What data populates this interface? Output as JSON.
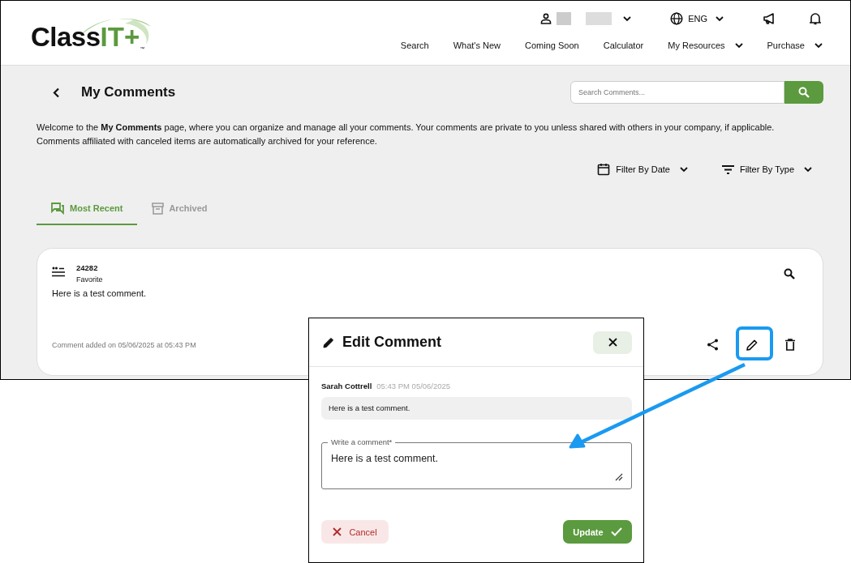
{
  "header": {
    "logo_text": "Class",
    "logo_accent": "IT+",
    "logo_tm": "™",
    "language": "ENG",
    "nav": [
      {
        "label": "Search",
        "dropdown": false
      },
      {
        "label": "What's New",
        "dropdown": false
      },
      {
        "label": "Coming Soon",
        "dropdown": false
      },
      {
        "label": "Calculator",
        "dropdown": false
      },
      {
        "label": "My Resources",
        "dropdown": true
      },
      {
        "label": "Purchase",
        "dropdown": true
      }
    ]
  },
  "page": {
    "title": "My Comments",
    "search": {
      "placeholder": "Search Comments..."
    },
    "intro": "Welcome to the **My Comments** page, where you can organize and manage all your comments. Your comments are private to you unless shared with others in your company, if applicable. Comments affiliated with canceled items are automatically archived for your reference.",
    "filters": [
      {
        "label": "Filter By Date",
        "kind": "date"
      },
      {
        "label": "Filter By Type",
        "kind": "type"
      }
    ],
    "tabs": [
      {
        "label": "Most Recent",
        "kind": "comments",
        "selected": true
      },
      {
        "label": "Archived",
        "kind": "archive",
        "selected": false
      }
    ]
  },
  "comment_card": {
    "id": "24282",
    "tag": "Favorite",
    "text": "Here is a test comment.",
    "added": "Comment added on 05/06/2025 at 05:43 PM"
  },
  "dialog": {
    "title": "Edit Comment",
    "author": "Sarah Cottrell",
    "time": "05:43 PM 05/06/2025",
    "previous": "Here is a test comment.",
    "field": {
      "label": "Write a comment*",
      "value": "Here is a test comment."
    },
    "cancel": "Cancel",
    "update": "Update"
  }
}
